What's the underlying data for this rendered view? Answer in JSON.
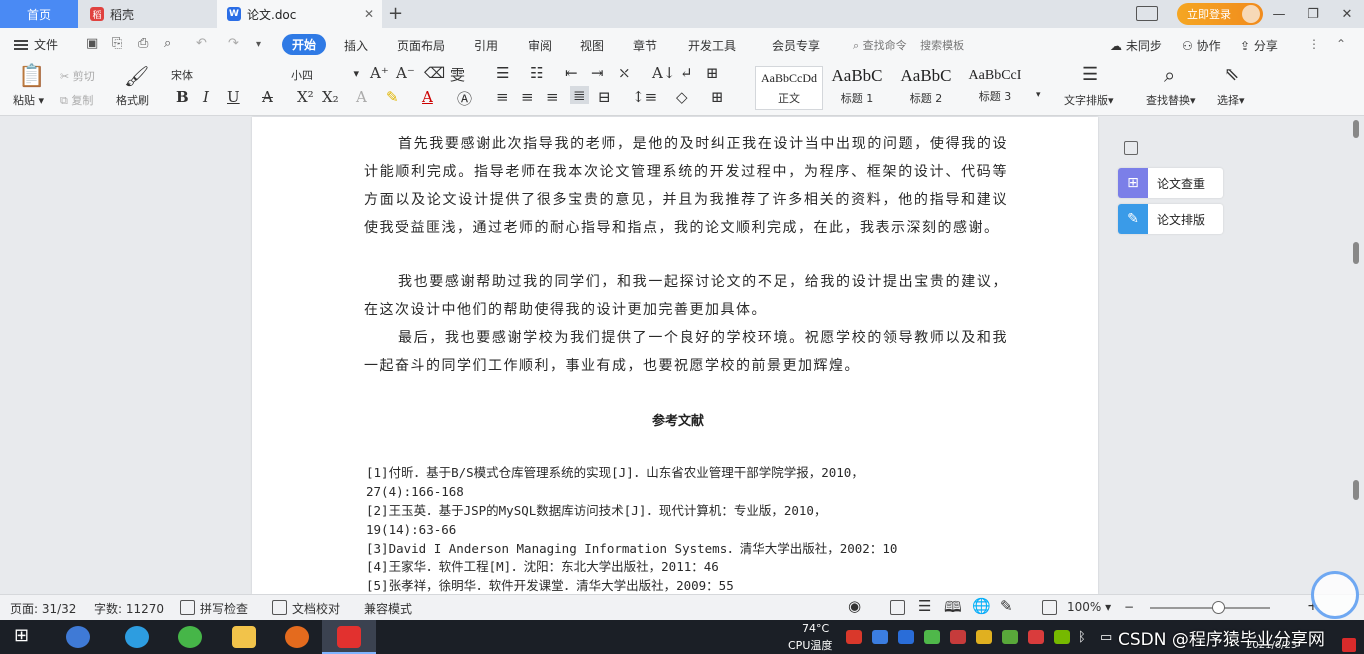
{
  "tabs": {
    "home": "首页",
    "daoke": "稻壳",
    "doc": "论文.doc",
    "add": "+"
  },
  "topbar": {
    "vip": "立即登录",
    "window_controls": [
      "—",
      "❐",
      "✕"
    ]
  },
  "menu": {
    "file": "文件",
    "quick_actions": [
      "↶",
      "↷"
    ],
    "items": [
      "开始",
      "插入",
      "页面布局",
      "引用",
      "审阅",
      "视图",
      "章节",
      "开发工具",
      "会员专享"
    ],
    "search_cmd": "查找命令",
    "search_template": "搜索模板",
    "sync": "未同步",
    "collab": "协作",
    "share": "分享"
  },
  "ribbon": {
    "paste": "粘贴",
    "cut": "剪切",
    "copy": "复制",
    "format_painter": "格式刷",
    "font_name": "宋体",
    "font_size": "小四",
    "styles": [
      {
        "sample": "AaBbCcDd",
        "name": "正文"
      },
      {
        "sample": "AaBbC",
        "name": "标题 1"
      },
      {
        "sample": "AaBbC",
        "name": "标题 2"
      },
      {
        "sample": "AaBbCcI",
        "name": "标题 3"
      }
    ],
    "text_layout": "文字排版",
    "find_replace": "查找替换",
    "select": "选择"
  },
  "document": {
    "paragraphs": [
      "首先我要感谢此次指导我的老师，是他的及时纠正我在设计当中出现的问题，使得我的设计能顺利完成。指导老师在我本次论文管理系统的开发过程中，为程序、框架的设计、代码等方面以及论文设计提供了很多宝贵的意见，并且为我推荐了许多相关的资料，他的指导和建议使我受益匪浅，通过老师的耐心指导和指点，我的论文顺利完成，在此，我表示深刻的感谢。",
      "我也要感谢帮助过我的同学们，和我一起探讨论文的不足，给我的设计提出宝贵的建议，在这次设计中他们的帮助使得我的设计更加完善更加具体。",
      "最后，我也要感谢学校为我们提供了一个良好的学校环境。祝愿学校的领导教师以及和我一起奋斗的同学们工作顺利，事业有成，也要祝愿学校的前景更加辉煌。"
    ],
    "references_title": "参考文献",
    "references": [
      "[1]付昕．基于B/S模式仓库管理系统的实现[J]．山东省农业管理干部学院学报，2010，",
      "27(4):166-168",
      "[2]王玉英．基于JSP的MySQL数据库访问技术[J]．现代计算机：专业版，2010，",
      "19(14):63-66",
      "[3]David I Anderson Managing Information Systems．清华大学出版社，2002：10",
      "[4]王家华．软件工程[M]．沈阳：东北大学出版社，2011：46",
      "[5]张孝祥，徐明华．软件开发课堂．清华大学出版社，2009：55"
    ]
  },
  "side_panel": {
    "check": "论文查重",
    "layout": "论文排版"
  },
  "statusbar": {
    "page": "页面: 31/32",
    "words": "字数: 11270",
    "spell": "拼写检查",
    "proof": "文档校对",
    "compat": "兼容模式",
    "zoom": "100%",
    "zoom_minus": "−",
    "zoom_plus": "+"
  },
  "taskbar": {
    "cpu_label": "CPU温度",
    "cpu_value": "74°C",
    "lang": "中",
    "date": "2021/6/23",
    "watermark": "CSDN @程序猿毕业分享网"
  },
  "colors": {
    "accent": "#2f7ae5",
    "home_tab": "#4a8af4",
    "taskbar": "#1b1f26",
    "side_check": "#7b7fe8",
    "side_layout": "#3a9be8"
  }
}
